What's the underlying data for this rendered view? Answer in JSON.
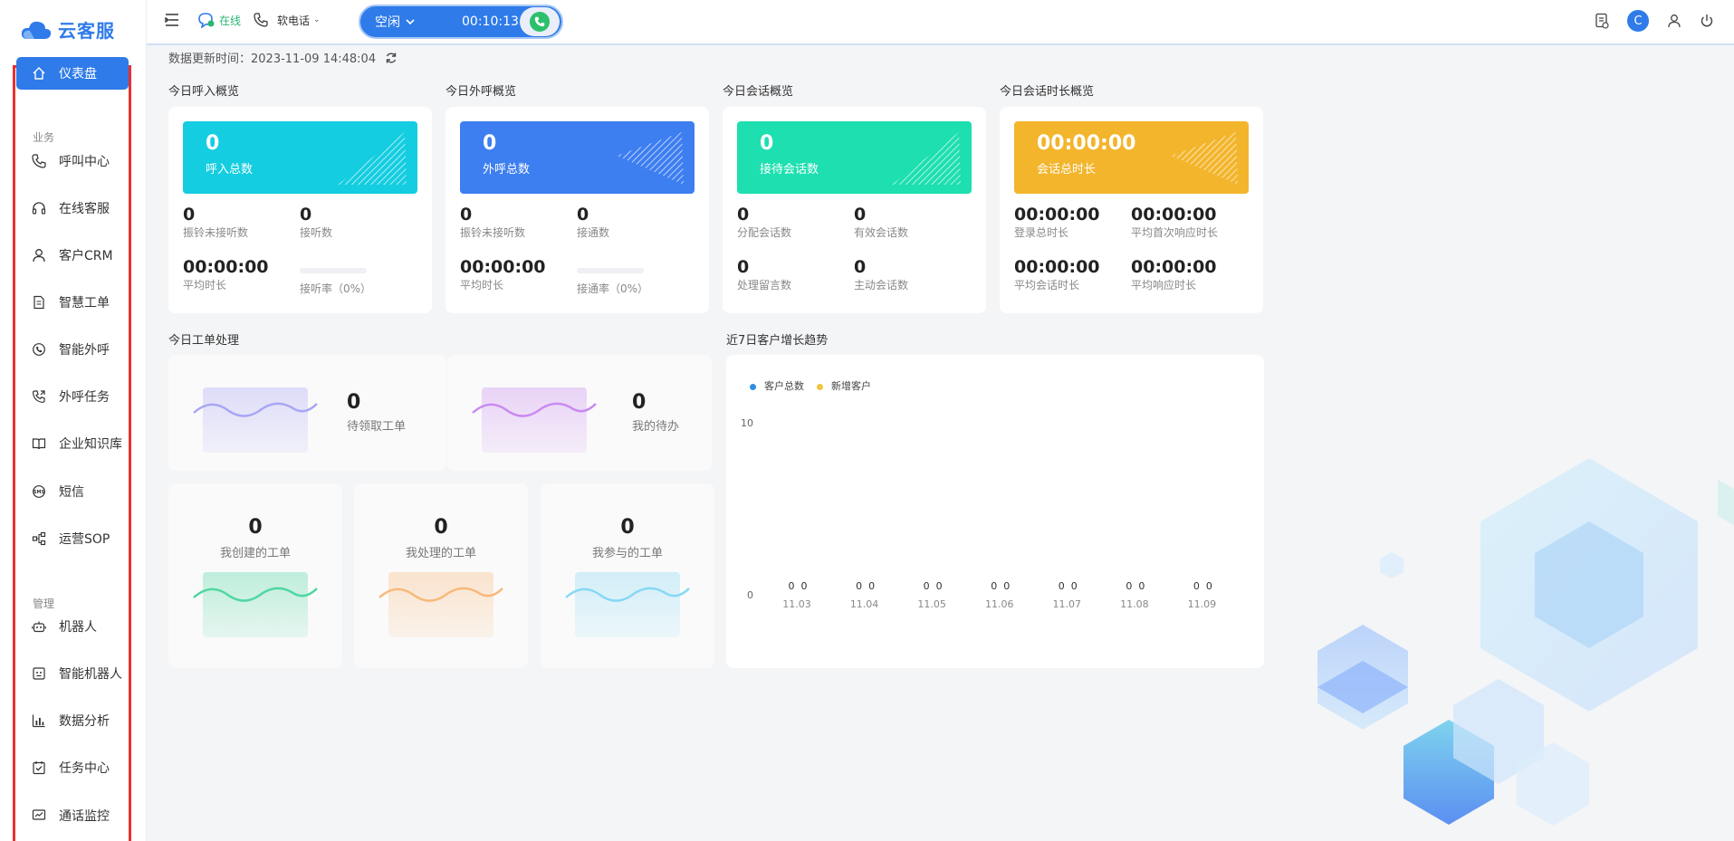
{
  "app": {
    "logo_text": "云客服"
  },
  "sidebar": {
    "items": [
      {
        "id": "dashboard",
        "label": "仪表盘",
        "icon": "home-icon",
        "active": true
      },
      {
        "id": "call-center",
        "label": "呼叫中心",
        "icon": "phone-icon"
      },
      {
        "id": "online-service",
        "label": "在线客服",
        "icon": "headset-icon"
      },
      {
        "id": "crm",
        "label": "客户CRM",
        "icon": "user-icon"
      },
      {
        "id": "ticket",
        "label": "智慧工单",
        "icon": "document-icon"
      },
      {
        "id": "outbound",
        "label": "智能外呼",
        "icon": "whatsapp-phone-icon"
      },
      {
        "id": "outbound-task",
        "label": "外呼任务",
        "icon": "phone-outgoing-icon"
      },
      {
        "id": "knowledge",
        "label": "企业知识库",
        "icon": "book-icon"
      },
      {
        "id": "sms",
        "label": "短信",
        "icon": "sms-icon"
      },
      {
        "id": "sop",
        "label": "运营SOP",
        "icon": "flow-icon"
      },
      {
        "id": "robot",
        "label": "机器人",
        "icon": "robot-icon"
      },
      {
        "id": "smart-robot",
        "label": "智能机器人",
        "icon": "smart-robot-icon"
      },
      {
        "id": "analytics",
        "label": "数据分析",
        "icon": "bar-chart-icon"
      },
      {
        "id": "task-center",
        "label": "任务中心",
        "icon": "checklist-icon"
      },
      {
        "id": "call-monitor",
        "label": "通话监控",
        "icon": "monitor-icon"
      }
    ],
    "section_business": "业务",
    "section_manage": "管理"
  },
  "topbar": {
    "status_online": "在线",
    "softphone": "软电话",
    "call_state": "空闲",
    "call_timer": "00:10:13",
    "avatar_letter": "C"
  },
  "main": {
    "update_label": "数据更新时间：",
    "update_time": "2023-11-09 14:48:04",
    "overview": [
      {
        "title": "今日呼入概览",
        "hero_value": "0",
        "hero_label": "呼入总数",
        "color": "#14cde0",
        "stats": [
          {
            "v": "0",
            "l": "振铃未接听数"
          },
          {
            "v": "0",
            "l": "接听数"
          },
          {
            "v": "00:00:00",
            "l": "平均时长"
          },
          {
            "v": "",
            "l": "接听率（0%）",
            "bar": true
          }
        ]
      },
      {
        "title": "今日外呼概览",
        "hero_value": "0",
        "hero_label": "外呼总数",
        "color": "#3d7ef0",
        "stats": [
          {
            "v": "0",
            "l": "振铃未接听数"
          },
          {
            "v": "0",
            "l": "接通数"
          },
          {
            "v": "00:00:00",
            "l": "平均时长"
          },
          {
            "v": "",
            "l": "接通率（0%）",
            "bar": true
          }
        ]
      },
      {
        "title": "今日会话概览",
        "hero_value": "0",
        "hero_label": "接待会话数",
        "color": "#1ddfb0",
        "stats": [
          {
            "v": "0",
            "l": "分配会话数"
          },
          {
            "v": "0",
            "l": "有效会话数"
          },
          {
            "v": "0",
            "l": "处理留言数"
          },
          {
            "v": "0",
            "l": "主动会话数"
          }
        ]
      },
      {
        "title": "今日会话时长概览",
        "hero_value": "00:00:00",
        "hero_label": "会话总时长",
        "color": "#f3b52c",
        "stats": [
          {
            "v": "00:00:00",
            "l": "登录总时长"
          },
          {
            "v": "00:00:00",
            "l": "平均首次响应时长"
          },
          {
            "v": "00:00:00",
            "l": "平均会话时长"
          },
          {
            "v": "00:00:00",
            "l": "平均响应时长"
          }
        ]
      }
    ],
    "workorder_title": "今日工单处理",
    "workorder_top": [
      {
        "v": "0",
        "l": "待领取工单",
        "color": "#a9a6f5"
      },
      {
        "v": "0",
        "l": "我的待办",
        "color": "#c98af0"
      }
    ],
    "workorder_bottom": [
      {
        "v": "0",
        "l": "我创建的工单",
        "color": "#4fd7a2"
      },
      {
        "v": "0",
        "l": "我处理的工单",
        "color": "#f8b97a"
      },
      {
        "v": "0",
        "l": "我参与的工单",
        "color": "#86d8f5"
      }
    ],
    "trend_title": "近7日客户增长趋势"
  },
  "chart_data": {
    "type": "bar",
    "title": "近7日客户增长趋势",
    "categories": [
      "11.03",
      "11.04",
      "11.05",
      "11.06",
      "11.07",
      "11.08",
      "11.09"
    ],
    "series": [
      {
        "name": "客户总数",
        "values": [
          0,
          0,
          0,
          0,
          0,
          0,
          0
        ],
        "color": "#2f8fe0"
      },
      {
        "name": "新增客户",
        "values": [
          0,
          0,
          0,
          0,
          0,
          0,
          0
        ],
        "color": "#f3c43a"
      }
    ],
    "ylim": [
      0,
      10
    ],
    "yticks": [
      "10",
      "0"
    ],
    "legend": "top-left"
  }
}
